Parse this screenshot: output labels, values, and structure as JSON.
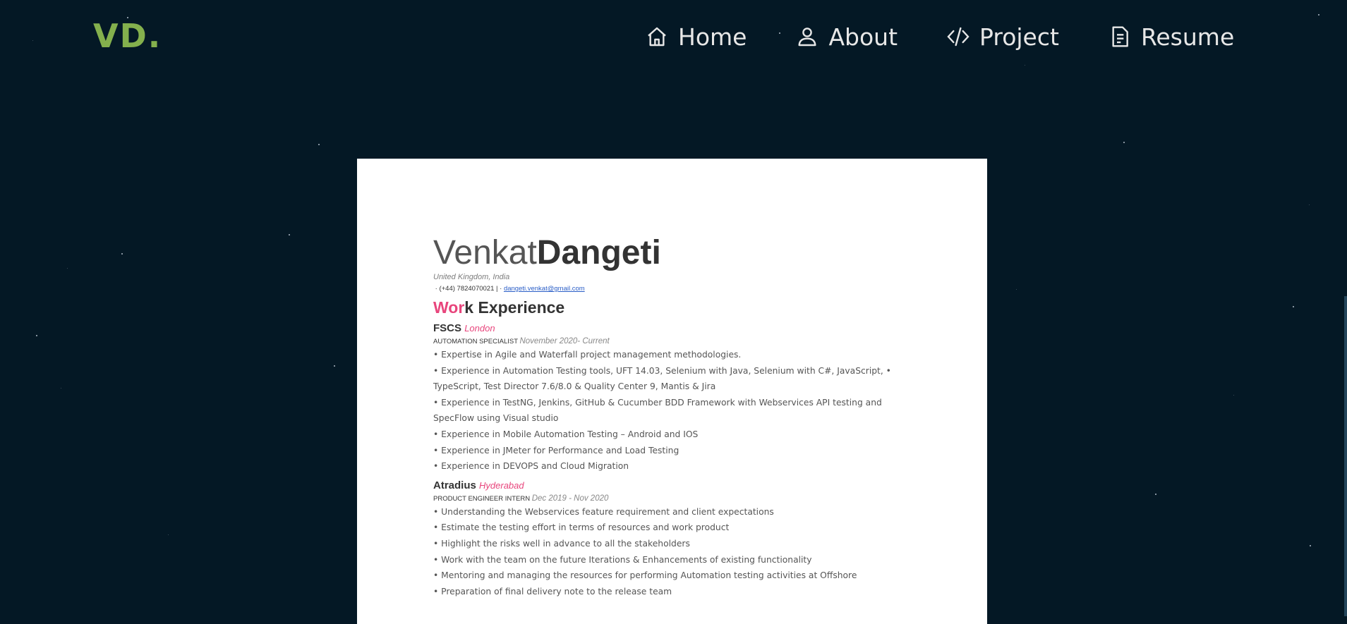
{
  "brand": {
    "logo": "VD."
  },
  "nav": [
    {
      "label": "Home",
      "icon": "home-icon"
    },
    {
      "label": "About",
      "icon": "user-icon"
    },
    {
      "label": "Project",
      "icon": "code-icon"
    },
    {
      "label": "Resume",
      "icon": "document-icon"
    }
  ],
  "colors": {
    "background": "#041825",
    "logo": "#84b04d",
    "accent": "#e8457c"
  },
  "resume": {
    "first_name": "Venkat",
    "last_name": "Dangeti",
    "location": "United Kingdom, India",
    "phone": "(+44) 7824070021 |",
    "email": "dangeti.venkat@gmail.com",
    "section_accent": "Wor",
    "section_rest": "k Experience",
    "jobs": [
      {
        "company": "FSCS",
        "city": "London",
        "role": "Automation Specialist",
        "dates": "November 2020-  Current",
        "bullets": [
          "• Expertise in Agile and Waterfall project management methodologies.",
          "• Experience in Automation Testing tools, UFT 14.03, Selenium with Java, Selenium with C#, JavaScript, •",
          "TypeScript, Test Director 7.6/8.0 & Quality Center 9, Mantis & Jira",
          "• Experience in TestNG, Jenkins, GitHub & Cucumber BDD Framework with Webservices API testing and",
          "SpecFlow using Visual studio",
          "• Experience in Mobile Automation Testing – Android and IOS",
          "• Experience in JMeter for Performance and Load Testing",
          "• Experience in DEVOPS and Cloud Migration"
        ]
      },
      {
        "company": "Atradius",
        "city": "Hyderabad",
        "role": "Product Engineer Intern",
        "dates": "Dec 2019 - Nov 2020",
        "bullets": [
          "• Understanding the Webservices feature requirement and client expectations",
          "• Estimate the testing effort in terms of resources and work product",
          "• Highlight the risks well in advance to all the stakeholders",
          "• Work with the team on the future Iterations & Enhancements of existing functionality",
          "• Mentoring and managing the resources for performing Automation testing activities at Offshore",
          "• Preparation of final delivery note to the release team"
        ]
      }
    ]
  }
}
